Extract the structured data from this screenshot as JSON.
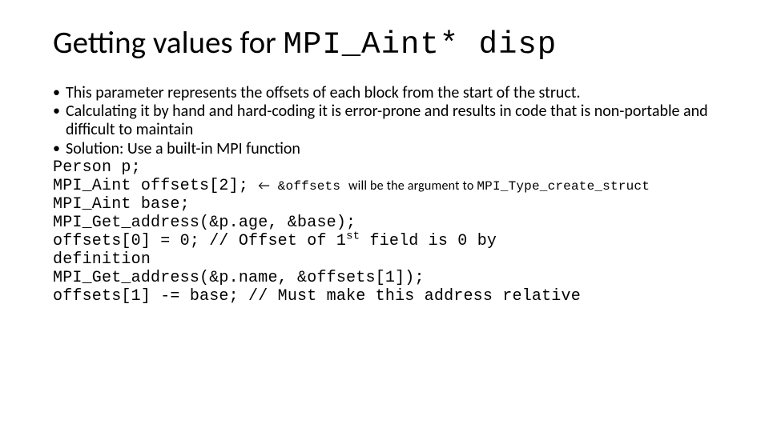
{
  "title_text": "Getting values for ",
  "title_code": "MPI_Aint* disp",
  "bullets": [
    "This parameter represents the offsets of each block from the start of the struct.",
    "Calculating it by hand and hard-coding it is error-prone and results in code that is non-portable and difficult to maintain",
    "Solution: Use a built-in MPI function"
  ],
  "code": {
    "l1": "Person p;",
    "l2_a": "MPI_Aint offsets[2]; ",
    "l2_arrow": "←",
    "l2_note_a": " &offsets ",
    "l2_note_b": "will be the argument to ",
    "l2_note_c": "MPI_Type_create_struct",
    "l3": "MPI_Aint base;",
    "l4": "MPI_Get_address(&p.age, &base);",
    "l5_a": "offsets[0] = 0;      // Offset of 1",
    "l5_sup": "st",
    "l5_b": " field is 0 by",
    "l5_c": "definition",
    "l6": "MPI_Get_address(&p.name, &offsets[1]);",
    "l7": "offsets[1] -= base; // Must make this address relative"
  }
}
